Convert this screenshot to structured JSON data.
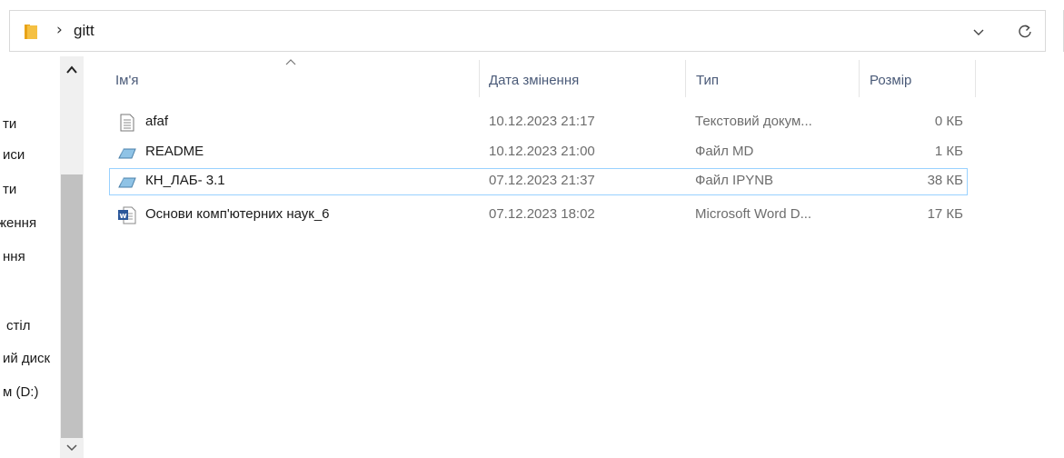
{
  "address_bar": {
    "path": "gitt",
    "separator": "›",
    "icons": {
      "folder": "folder-icon",
      "dropdown": "chevron-down-icon",
      "refresh": "refresh-icon"
    }
  },
  "nav_pane": {
    "items": [
      "ти",
      "иси",
      "ти",
      "ження",
      "ння",
      "стіл",
      "ий диск",
      "м (D:)"
    ]
  },
  "columns": {
    "name": "Ім'я",
    "date": "Дата змінення",
    "type": "Тип",
    "size": "Розмір"
  },
  "files": [
    {
      "name": "afaf",
      "date": "10.12.2023 21:17",
      "type": "Текстовий докум...",
      "size": "0 КБ",
      "icon": "text-file-icon",
      "selected": false
    },
    {
      "name": "README",
      "date": "10.12.2023 21:00",
      "type": "Файл MD",
      "size": "1 КБ",
      "icon": "md-file-icon",
      "selected": false
    },
    {
      "name": "КН_ЛАБ- 3.1",
      "date": "07.12.2023 21:37",
      "type": "Файл IPYNB",
      "size": "38 КБ",
      "icon": "ipynb-file-icon",
      "selected": true
    },
    {
      "name": "Основи комп'ютерних наук_6",
      "date": "07.12.2023 18:02",
      "type": "Microsoft Word D...",
      "size": "17 КБ",
      "icon": "word-file-icon",
      "selected": false
    }
  ],
  "colors": {
    "selection_border": "#99d1ff",
    "header_text": "#4a5a78",
    "secondary_text": "#6d6d6d",
    "folder_yellow": "#f5c042",
    "word_blue": "#2b579a"
  }
}
